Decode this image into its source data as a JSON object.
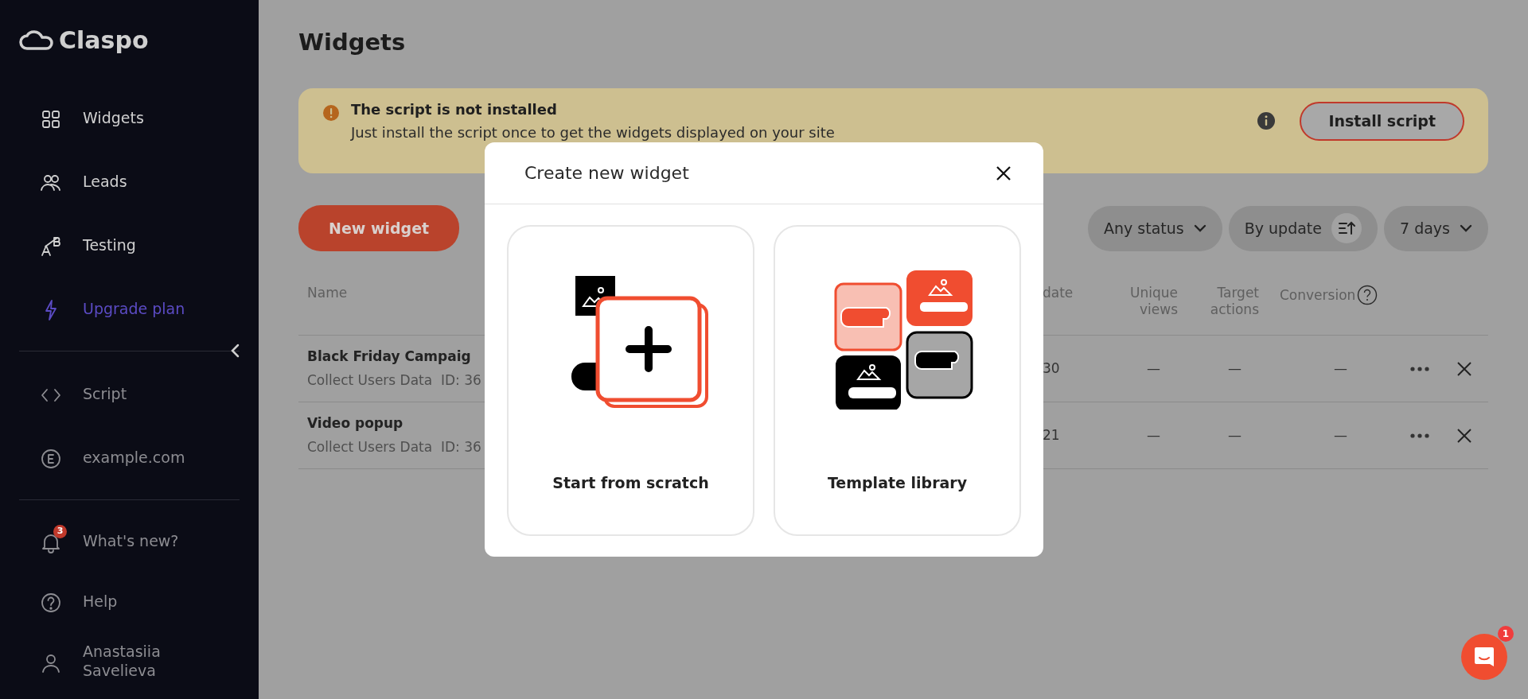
{
  "sidebar": {
    "logo": "Claspo",
    "main_items": [
      {
        "label": "Widgets",
        "kind": "widgets"
      },
      {
        "label": "Leads",
        "kind": "leads"
      },
      {
        "label": "Testing",
        "kind": "testing"
      },
      {
        "label": "Upgrade plan",
        "kind": "upgrade"
      }
    ],
    "site_items": [
      {
        "label": "Script",
        "kind": "script"
      },
      {
        "label": "example.com",
        "kind": "site"
      }
    ],
    "footer_items": [
      {
        "label": "What's new?",
        "kind": "news",
        "badge": "3"
      },
      {
        "label": "Help",
        "kind": "help"
      },
      {
        "label": "Anastasiia Savelieva",
        "kind": "user"
      }
    ]
  },
  "page": {
    "title": "Widgets"
  },
  "banner": {
    "title": "The script is not installed",
    "text": "Just install the script once to get the widgets displayed on your site",
    "button": "Install script"
  },
  "toolbar": {
    "new_button": "New widget",
    "filters": [
      {
        "label": "Any status",
        "kind": "dropdown"
      },
      {
        "label": "By update",
        "kind": "sort"
      },
      {
        "label": "7 days",
        "kind": "dropdown"
      }
    ]
  },
  "table": {
    "columns": [
      {
        "label": "Name"
      },
      {
        "label": "date"
      },
      {
        "label": "Unique views"
      },
      {
        "label": "Target actions"
      },
      {
        "label": "Conversion",
        "kind": "with_help"
      }
    ],
    "rows": [
      {
        "name": "Black Friday Campaig",
        "meta": "Collect Users Data  ID: 36",
        "date": "30",
        "unique_views": "—",
        "target_actions": "—",
        "conversion": "—"
      },
      {
        "name": "Video popup",
        "meta": "Collect Users Data  ID: 36",
        "date": "21",
        "unique_views": "—",
        "target_actions": "—",
        "conversion": "—"
      }
    ]
  },
  "modal": {
    "title": "Create new widget",
    "options": [
      {
        "label": "Start from scratch",
        "kind": "scratch"
      },
      {
        "label": "Template library",
        "kind": "library"
      }
    ]
  },
  "chat": {
    "badge": "1"
  }
}
